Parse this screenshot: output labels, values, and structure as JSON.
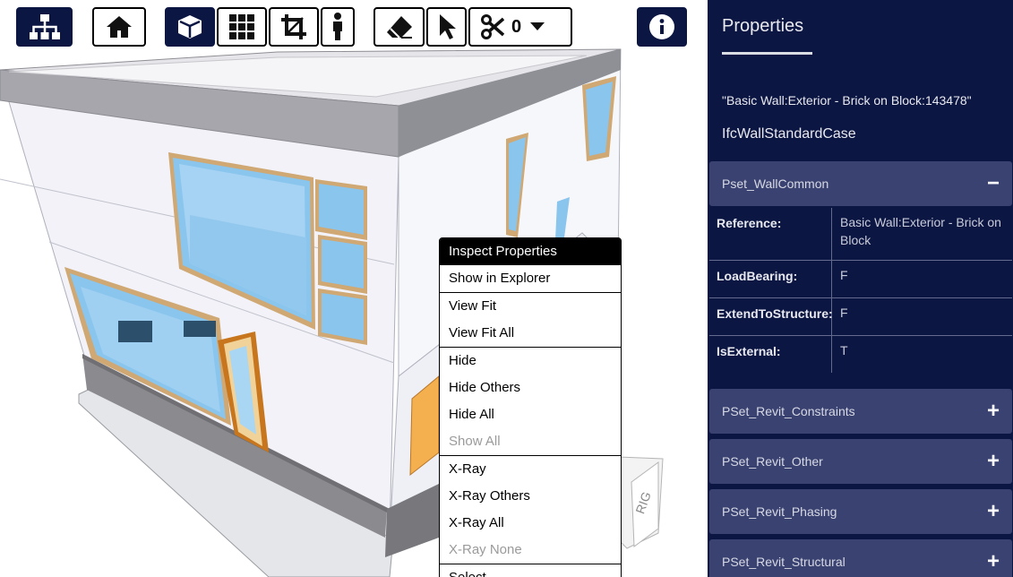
{
  "toolbar": {
    "buttons": [
      {
        "name": "tree-icon",
        "label": "Model explorer"
      },
      {
        "name": "home-icon",
        "label": "Home view"
      },
      {
        "name": "cube-icon",
        "label": "3D view"
      },
      {
        "name": "grid-icon",
        "label": "Plan view"
      },
      {
        "name": "crop-icon",
        "label": "Section box"
      },
      {
        "name": "person-icon",
        "label": "First person"
      },
      {
        "name": "eraser-icon",
        "label": "Clear"
      },
      {
        "name": "cursor-icon",
        "label": "Select"
      },
      {
        "name": "scissors-icon",
        "label": "Section planes"
      },
      {
        "name": "info-icon",
        "label": "Properties"
      }
    ],
    "section_count": "0"
  },
  "context_menu": {
    "groups": [
      [
        {
          "label": "Inspect Properties",
          "state": "highlighted"
        },
        {
          "label": "Show in Explorer"
        }
      ],
      [
        {
          "label": "View Fit"
        },
        {
          "label": "View Fit All"
        }
      ],
      [
        {
          "label": "Hide"
        },
        {
          "label": "Hide Others"
        },
        {
          "label": "Hide All"
        },
        {
          "label": "Show All",
          "state": "disabled"
        }
      ],
      [
        {
          "label": "X-Ray"
        },
        {
          "label": "X-Ray Others"
        },
        {
          "label": "X-Ray All"
        },
        {
          "label": "X-Ray None",
          "state": "disabled"
        }
      ],
      [
        {
          "label": "Select"
        }
      ]
    ]
  },
  "properties": {
    "title": "Properties",
    "object_name": "\"Basic Wall:Exterior - Brick on Block:143478\"",
    "object_type": "IfcWallStandardCase",
    "psets": [
      {
        "name": "Pset_WallCommon",
        "expanded": true,
        "symbol": "−"
      },
      {
        "name": "PSet_Revit_Constraints",
        "expanded": false,
        "symbol": "+"
      },
      {
        "name": "PSet_Revit_Other",
        "expanded": false,
        "symbol": "+"
      },
      {
        "name": "PSet_Revit_Phasing",
        "expanded": false,
        "symbol": "+"
      },
      {
        "name": "PSet_Revit_Structural",
        "expanded": false,
        "symbol": "+"
      }
    ],
    "rows": [
      {
        "key": "Reference:",
        "value": "Basic Wall:Exterior - Brick on Block"
      },
      {
        "key": "LoadBearing:",
        "value": "F"
      },
      {
        "key": "ExtendToStructure:",
        "value": "F"
      },
      {
        "key": "IsExternal:",
        "value": "T"
      }
    ]
  },
  "colors": {
    "panel_bg": "#0c1643",
    "pset_bg": "#3a4272",
    "highlight": "#000000"
  }
}
